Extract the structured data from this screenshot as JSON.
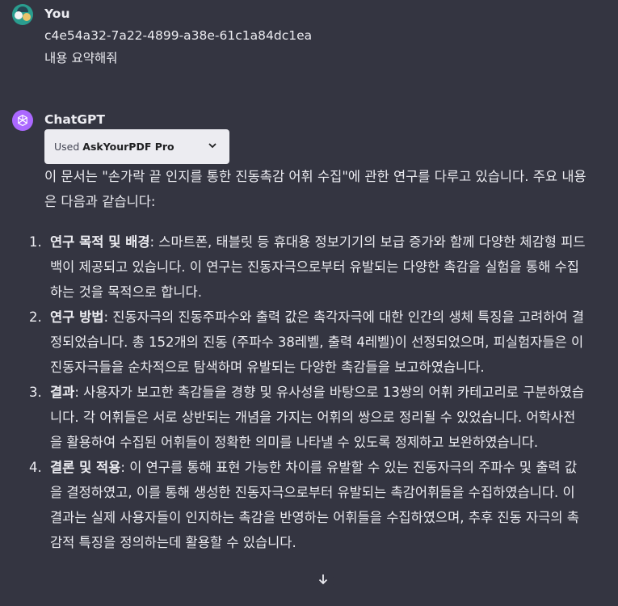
{
  "user_message": {
    "author": "You",
    "lines": [
      "c4e54a32-7a22-4899-a38e-61c1a84dc1ea",
      "내용 요약해줘"
    ]
  },
  "assistant_message": {
    "author": "ChatGPT",
    "plugin": {
      "used_label": "Used",
      "name": "AskYourPDF Pro"
    },
    "intro": "이 문서는 \"손가락 끝 인지를 통한 진동촉감 어휘 수집\"에 관한 연구를 다루고 있습니다. 주요 내용은 다음과 같습니다:",
    "points": [
      {
        "num": "1.",
        "title": "연구 목적 및 배경",
        "text": ": 스마트폰, 태블릿 등 휴대용 정보기기의 보급 증가와 함께 다양한 체감형 피드백이 제공되고 있습니다. 이 연구는 진동자극으로부터 유발되는 다양한 촉감을 실험을 통해 수집하는 것을 목적으로 합니다."
      },
      {
        "num": "2.",
        "title": "연구 방법",
        "text": ": 진동자극의 진동주파수와 출력 값은 촉각자극에 대한 인간의 생체 특징을 고려하여 결정되었습니다. 총 152개의 진동 (주파수 38레벨, 출력 4레벨)이 선정되었으며, 피실험자들은 이 진동자극들을 순차적으로 탐색하며 유발되는 다양한 촉감들을 보고하였습니다."
      },
      {
        "num": "3.",
        "title": "결과",
        "text": ": 사용자가 보고한 촉감들을 경향 및 유사성을 바탕으로 13쌍의 어휘 카테고리로 구분하였습니다. 각 어휘들은 서로 상반되는 개념을 가지는 어휘의 쌍으로 정리될 수 있었습니다. 어학사전을 활용하여 수집된 어휘들이 정확한 의미를 나타낼 수 있도록 정제하고 보완하였습니다."
      },
      {
        "num": "4.",
        "title": "결론 및 적용",
        "text": ": 이 연구를 통해 표현 가능한 차이를 유발할 수 있는 진동자극의 주파수 및 출력 값을 결정하였고, 이를 통해 생성한 진동자극으로부터 유발되는 촉감어휘들을 수집하였습니다. 이 결과는 실제 사용자들이 인지하는 촉감을 반영하는 어휘들을 수집하였으며, 추후 진동 자극의 촉감적 특징을 정의하는데 활용할 수 있습니다."
      }
    ]
  },
  "icons": {
    "chevron": "chevron-down-icon",
    "scroll": "arrow-down-icon",
    "gpt": "openai-logo-icon"
  }
}
